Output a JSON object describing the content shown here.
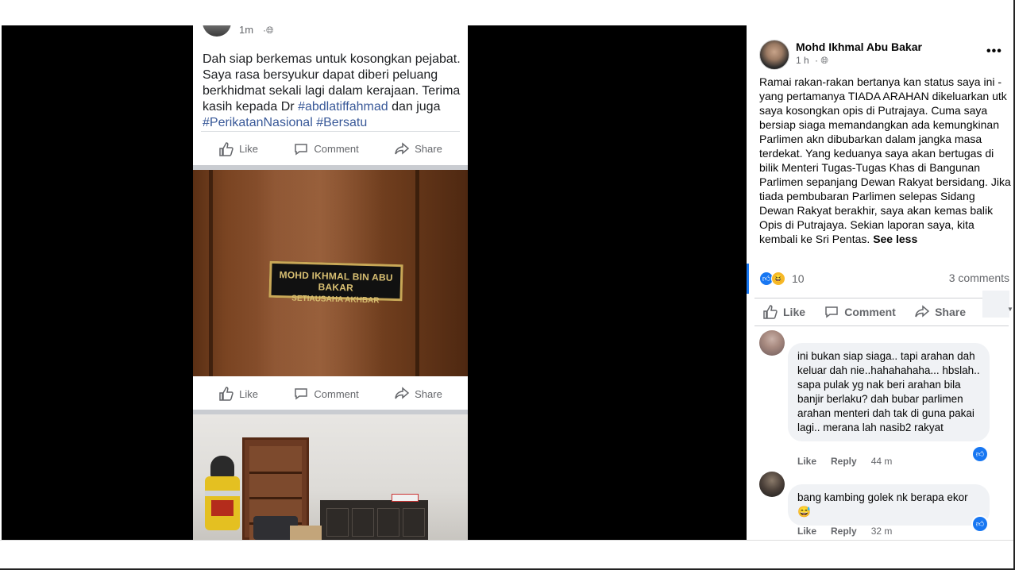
{
  "embed": {
    "time": "1m",
    "post_text_1": "Dah siap berkemas untuk kosongkan pejabat. Saya rasa bersyukur dapat diberi peluang berkhidmat sekali lagi dalam kerajaan. Terima kasih kepada Dr ",
    "hashtag_1": "#abdlatiffahmad",
    "post_text_2": " dan juga ",
    "hashtag_2": "#PerikatanNasional",
    "hashtag_3": "#Bersatu",
    "actions": {
      "like": "Like",
      "comment": "Comment",
      "share": "Share"
    },
    "plate_line_1": "MOHD IKHMAL BIN ABU BAKAR",
    "plate_line_2": "SETIAUSAHA AKHBAR"
  },
  "panel": {
    "author": "Mohd Ikhmal Abu Bakar",
    "time": "1 h",
    "more": "•••",
    "body": "Ramai rakan-rakan bertanya kan status saya ini - yang pertamanya TIADA ARAHAN dikeluarkan utk saya kosongkan opis di Putrajaya. Cuma saya bersiap siaga memandangkan ada kemungkinan Parlimen akn dibubarkan dalam jangka masa terdekat. Yang keduanya saya akan bertugas di bilik Menteri Tugas-Tugas Khas di Bangunan Parlimen sepanjang Dewan Rakyat bersidang. Jika tiada pembubaran Parlimen selepas Sidang Dewan Rakyat berakhir, saya akan kemas balik Opis di Putrajaya. Sekian laporan saya, kita kembali ke Sri Pentas.",
    "see_less": "See less",
    "reaction_count": "10",
    "comments_count": "3 comments",
    "actions": {
      "like": "Like",
      "comment": "Comment",
      "share": "Share"
    }
  },
  "comments": [
    {
      "text": "ini bukan siap siaga.. tapi arahan dah keluar dah nie..hahahahaha... hbslah.. sapa pulak yg nak beri arahan bila banjir berlaku? dah bubar parlimen arahan menteri dah tak di guna pakai lagi.. merana lah nasib2 rakyat",
      "like": "Like",
      "reply": "Reply",
      "time": "44 m"
    },
    {
      "text": "bang kambing golek nk berapa ekor 😅",
      "like": "Like",
      "reply": "Reply",
      "time": "32 m"
    }
  ]
}
